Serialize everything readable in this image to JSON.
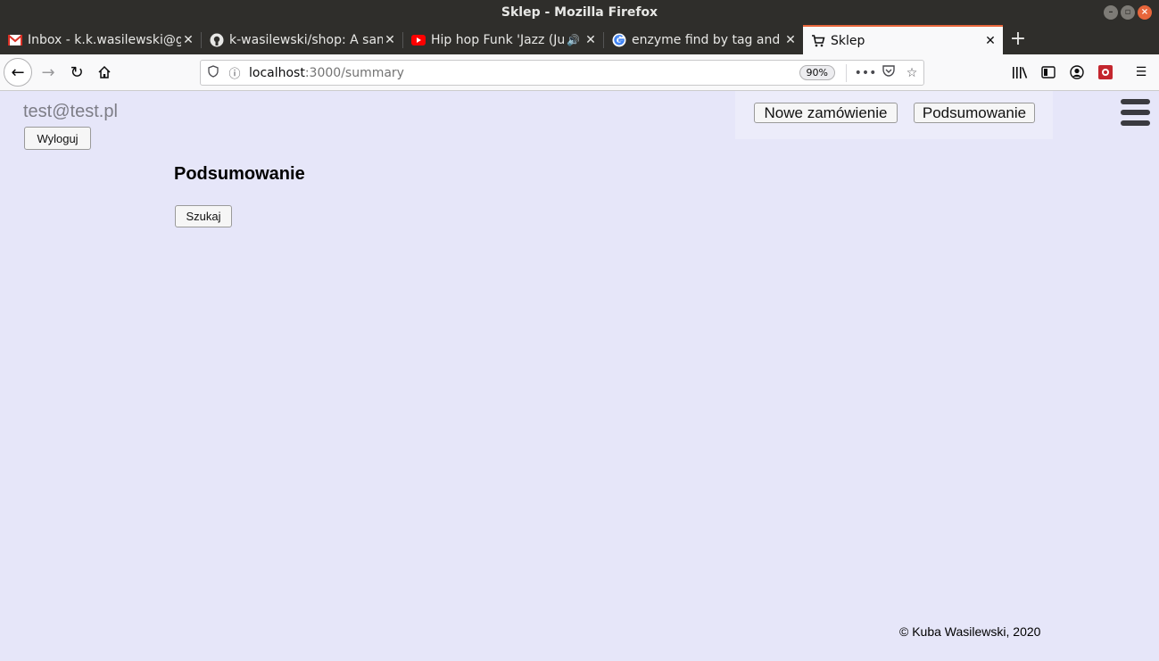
{
  "window": {
    "title": "Sklep - Mozilla Firefox"
  },
  "tabs": [
    {
      "label": "Inbox - k.k.wasilewski@gmail.com",
      "icon": "gmail-icon"
    },
    {
      "label": "k-wasilewski/shop: A sample shop",
      "icon": "github-icon"
    },
    {
      "label": "Hip hop Funk 'Jazz (Ju",
      "icon": "youtube-icon"
    },
    {
      "label": "enzyme find by tag and attribute",
      "icon": "google-icon"
    },
    {
      "label": "Sklep",
      "icon": "cart-icon"
    }
  ],
  "navbar": {
    "url_host": "localhost",
    "url_path": ":3000/summary",
    "zoom": "90%"
  },
  "header": {
    "user_email": "test@test.pl",
    "logout_label": "Wyloguj",
    "menu": {
      "new_order_label": "Nowe zamówienie",
      "summary_label": "Podsumowanie"
    }
  },
  "main": {
    "title": "Podsumowanie",
    "search_label": "Szukaj"
  },
  "footer": {
    "text": "© Kuba Wasilewski, 2020"
  },
  "colors": {
    "page_background": "#e6e6f9",
    "active_tab_accent": "#e8663b"
  }
}
